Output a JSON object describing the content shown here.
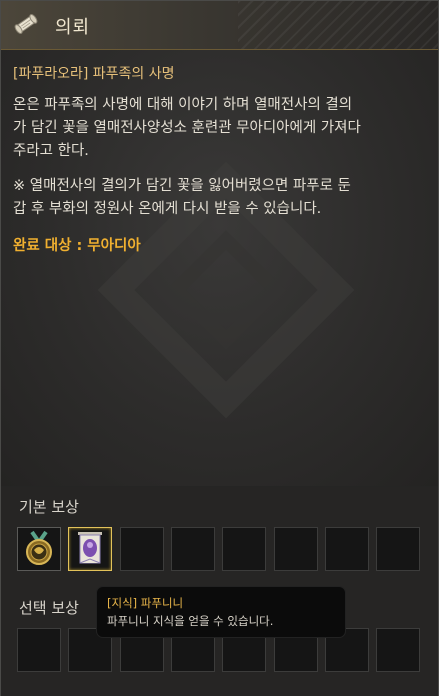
{
  "window": {
    "title": "의뢰"
  },
  "quest": {
    "name": "[파푸라오라] 파푸족의 사명",
    "description_lines": [
      "온은 파푸족의 사명에 대해 이야기 하며 열매전사의 결의",
      "가 담긴 꽃을 열매전사양성소 훈련관 무아디아에게 가져다",
      "주라고 한다."
    ],
    "note_lines": [
      "※ 열매전사의 결의가 담긴 꽃을 잃어버렸으면 파푸로 둔",
      "갑 후 부화의 정원사 온에게 다시 받을 수 있습니다."
    ],
    "completion": "완료 대상 : 무아디아"
  },
  "rewards": {
    "basic_label": "기본 보상",
    "choice_label": "선택 보상",
    "basic_slots": [
      {
        "icon": "medal-icon",
        "filled": true
      },
      {
        "icon": "knowledge-banner-icon",
        "filled": true,
        "selected": true
      },
      {
        "filled": false
      },
      {
        "filled": false
      },
      {
        "filled": false
      },
      {
        "filled": false
      },
      {
        "filled": false
      },
      {
        "filled": false
      }
    ],
    "choice_slots": [
      {
        "filled": false
      },
      {
        "filled": false
      },
      {
        "filled": false
      },
      {
        "filled": false
      },
      {
        "filled": false
      },
      {
        "filled": false
      },
      {
        "filled": false
      },
      {
        "filled": false
      }
    ]
  },
  "tooltip": {
    "title": "[지식] 파푸니니",
    "body": "파푸니니 지식을 얻을 수 있습니다."
  },
  "colors": {
    "quest_name": "#e6c07a",
    "completion": "#f0b030",
    "tooltip_title": "#e8b54a",
    "selected_border": "#e3c35a"
  }
}
